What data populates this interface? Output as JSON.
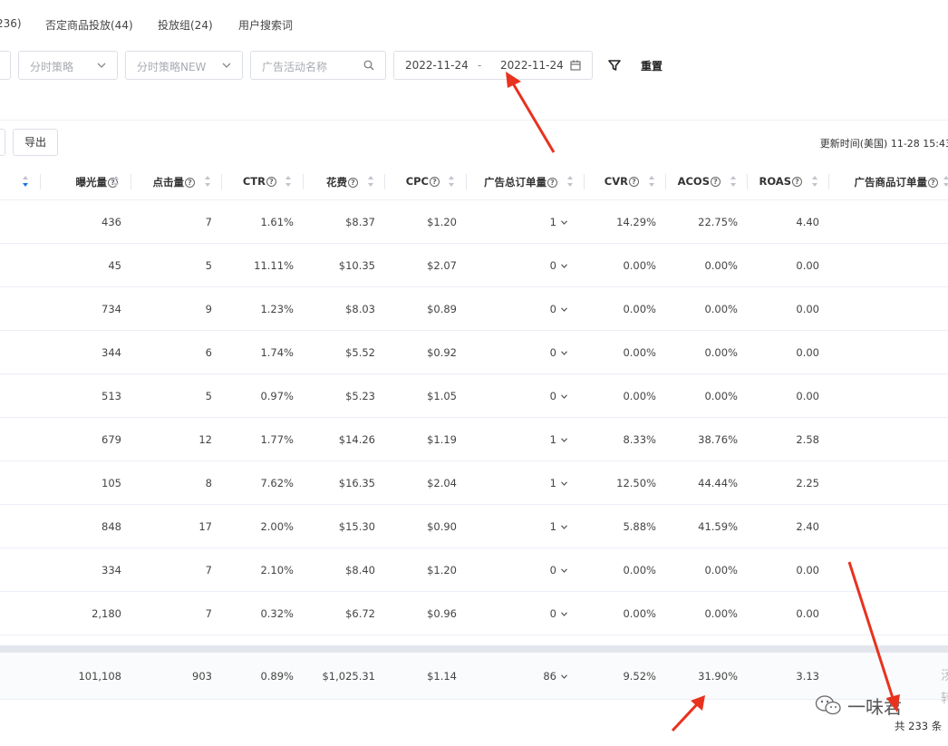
{
  "tabs": [
    {
      "label": "236)"
    },
    {
      "label": "否定商品投放(44)"
    },
    {
      "label": "投放组(24)"
    },
    {
      "label": "用户搜索词"
    }
  ],
  "filters": {
    "strategy_placeholder": "分时策略",
    "strategy_new_placeholder": "分时策略NEW",
    "campaign_search_placeholder": "广告活动名称",
    "date_start": "2022-11-24",
    "date_separator": "-",
    "date_end": "2022-11-24",
    "reset_label": "重置"
  },
  "toolbar": {
    "export_label": "导出",
    "update_time": "更新时间(美国) 11-28 15:43"
  },
  "table": {
    "columns": [
      "曝光量",
      "点击量",
      "CTR",
      "花费",
      "CPC",
      "广告总订单量",
      "CVR",
      "ACOS",
      "ROAS",
      "广告商品订单量"
    ],
    "help_mark": "?",
    "rows": [
      [
        "436",
        "7",
        "1.61%",
        "$8.37",
        "$1.20",
        "1",
        "14.29%",
        "22.75%",
        "4.40"
      ],
      [
        "45",
        "5",
        "11.11%",
        "$10.35",
        "$2.07",
        "0",
        "0.00%",
        "0.00%",
        "0.00"
      ],
      [
        "734",
        "9",
        "1.23%",
        "$8.03",
        "$0.89",
        "0",
        "0.00%",
        "0.00%",
        "0.00"
      ],
      [
        "344",
        "6",
        "1.74%",
        "$5.52",
        "$0.92",
        "0",
        "0.00%",
        "0.00%",
        "0.00"
      ],
      [
        "513",
        "5",
        "0.97%",
        "$5.23",
        "$1.05",
        "0",
        "0.00%",
        "0.00%",
        "0.00"
      ],
      [
        "679",
        "12",
        "1.77%",
        "$14.26",
        "$1.19",
        "1",
        "8.33%",
        "38.76%",
        "2.58"
      ],
      [
        "105",
        "8",
        "7.62%",
        "$16.35",
        "$2.04",
        "1",
        "12.50%",
        "44.44%",
        "2.25"
      ],
      [
        "848",
        "17",
        "2.00%",
        "$15.30",
        "$0.90",
        "1",
        "5.88%",
        "41.59%",
        "2.40"
      ],
      [
        "334",
        "7",
        "2.10%",
        "$8.40",
        "$1.20",
        "0",
        "0.00%",
        "0.00%",
        "0.00"
      ],
      [
        "2,180",
        "7",
        "0.32%",
        "$6.72",
        "$0.96",
        "0",
        "0.00%",
        "0.00%",
        "0.00"
      ]
    ],
    "totals": [
      "101,108",
      "903",
      "0.89%",
      "$1,025.31",
      "$1.14",
      "86",
      "9.52%",
      "31.90%",
      "3.13"
    ],
    "edge_chars": [
      "汤",
      "转"
    ]
  },
  "footer": {
    "watermark_text": "一味君",
    "total_count": "共 233 条"
  },
  "colors": {
    "accent": "#1a73e8",
    "arrow": "#e8321e",
    "border": "#dcdfe6"
  }
}
